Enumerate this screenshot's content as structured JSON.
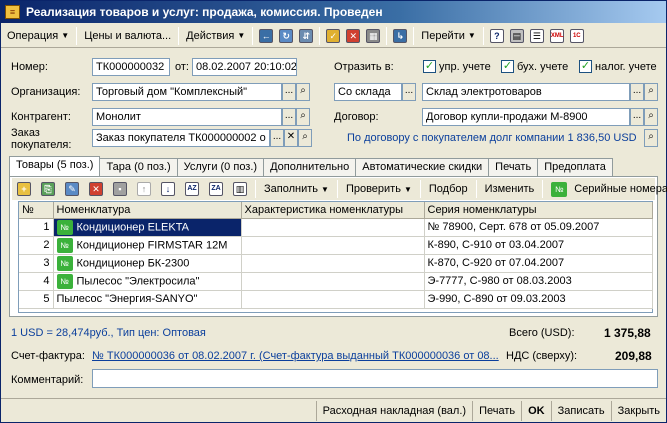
{
  "window": {
    "title": "Реализация товаров и услуг: продажа, комиссия. Проведен"
  },
  "toolbar": {
    "operation": "Операция",
    "prices": "Цены и валюта...",
    "actions": "Действия",
    "goto": "Перейти"
  },
  "header": {
    "number_label": "Номер:",
    "number_value": "ТК000000032",
    "date_label": "от:",
    "date_value": "08.02.2007 20:10:02",
    "reflect_label": "Отразить в:",
    "reflect_mgmt": "упр. учете",
    "reflect_acc": "бух. учете",
    "reflect_tax": "налог. учете",
    "org_label": "Организация:",
    "org_value": "Торговый дом \"Комплексный\"",
    "from_wh_value": "Со склада",
    "warehouse_value": "Склад электротоваров",
    "contractor_label": "Контрагент:",
    "contractor_value": "Монолит",
    "contract_label": "Договор:",
    "contract_value": "Договор купли-продажи М-8900",
    "order_label": "Заказ покупателя:",
    "order_value": "Заказ покупателя ТК000000002 о",
    "debt_text": "По договору с покупателем долг компании 1 836,50 USD"
  },
  "tabs": [
    "Товары (5 поз.)",
    "Тара (0 поз.)",
    "Услуги (0 поз.)",
    "Дополнительно",
    "Автоматические скидки",
    "Печать",
    "Предоплата"
  ],
  "grid_toolbar": {
    "fill": "Заполнить",
    "check": "Проверить",
    "pick": "Подбор",
    "edit": "Изменить",
    "serials": "Серийные номера"
  },
  "grid": {
    "columns": [
      "№",
      "Номенклатура",
      "Характеристика номенклатуры",
      "Серия номенклатуры"
    ],
    "rows": [
      {
        "n": "1",
        "nom": "Кондиционер ELEKTA",
        "char": "",
        "series": "№ 78900, Серт. 678 от 05.09.2007",
        "badge": true
      },
      {
        "n": "2",
        "nom": "Кондиционер FIRMSTAR 12M",
        "char": "",
        "series": "К-890, С-910 от 03.04.2007",
        "badge": true
      },
      {
        "n": "3",
        "nom": "Кондиционер БК-2300",
        "char": "",
        "series": "К-870, С-920 от 07.04.2007",
        "badge": true
      },
      {
        "n": "4",
        "nom": "Пылесос \"Электросила\"",
        "char": "",
        "series": "Э-7777, С-980 от 08.03.2003",
        "badge": true
      },
      {
        "n": "5",
        "nom": "Пылесос \"Энергия-SANYO\"",
        "char": "",
        "series": "Э-990, С-890 от 09.03.2003",
        "badge": false
      }
    ]
  },
  "footer": {
    "rate_text": "1 USD = 28,474руб., Тип цен: Оптовая",
    "total_label": "Всего (USD):",
    "total_value": "1 375,88",
    "invoice_label": "Счет-фактура:",
    "invoice_value": "№ ТК000000036 от 08.02.2007 г. (Счет-фактура выданный ТК000000036 от 08...",
    "vat_label": "НДС (сверху):",
    "vat_value": "209,88",
    "comment_label": "Комментарий:"
  },
  "bottom_bar": {
    "waybill": "Расходная накладная (вал.)",
    "print": "Печать",
    "ok": "OK",
    "save": "Записать",
    "close": "Закрыть"
  }
}
